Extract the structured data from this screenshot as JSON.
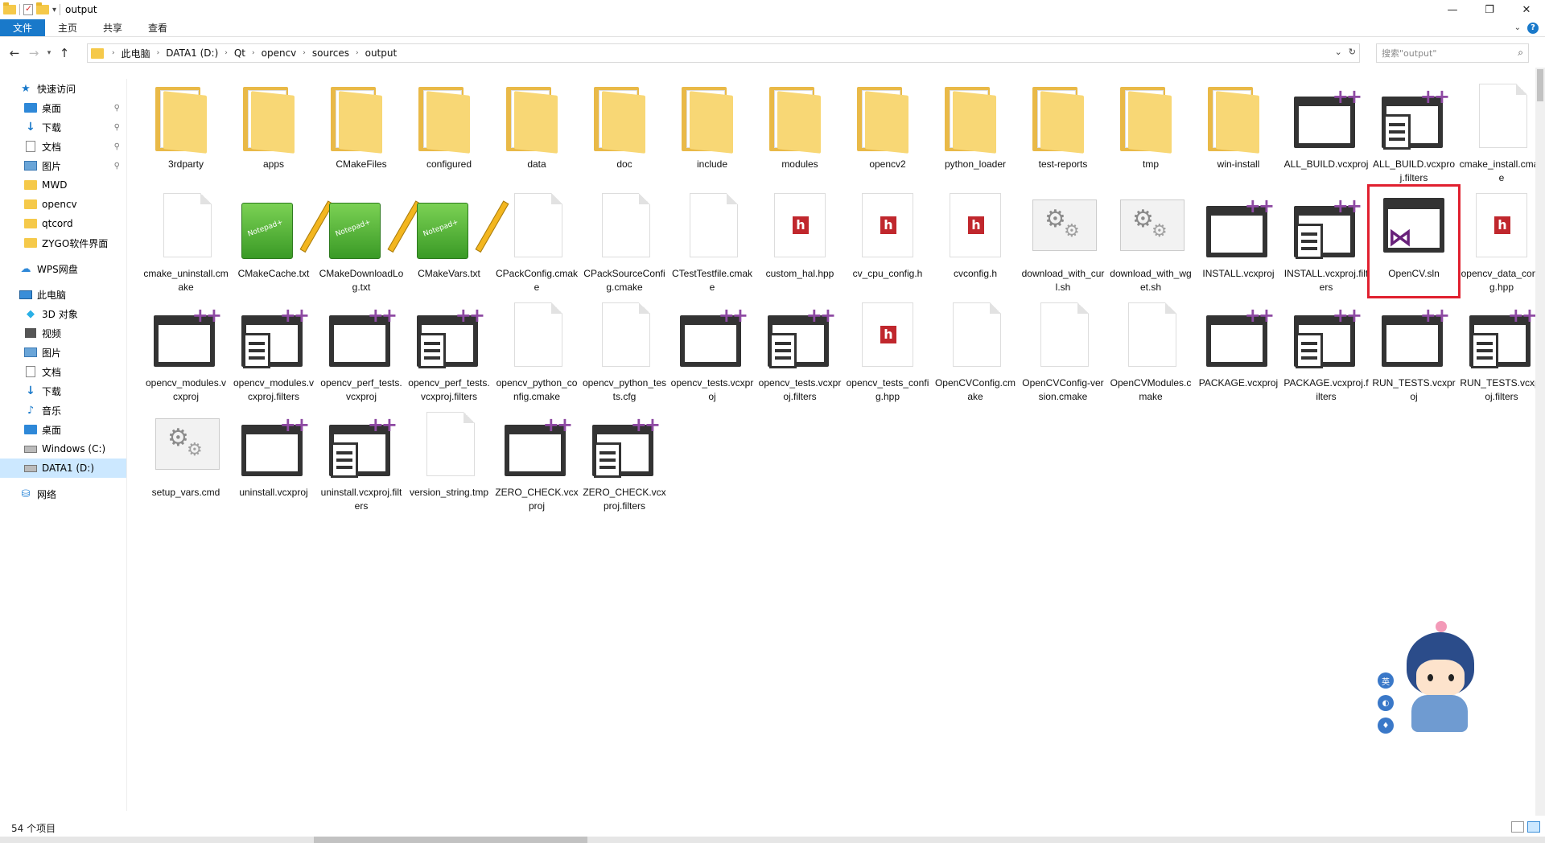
{
  "window": {
    "title": "output",
    "minimize": "—",
    "maximize": "❐",
    "close": "✕"
  },
  "ribbon": {
    "tabs": [
      "文件",
      "主页",
      "共享",
      "查看"
    ]
  },
  "address": {
    "crumbs": [
      "此电脑",
      "DATA1 (D:)",
      "Qt",
      "opencv",
      "sources",
      "output"
    ]
  },
  "search": {
    "placeholder": "搜索\"output\""
  },
  "sidebar": {
    "items": [
      {
        "label": "快速访问",
        "icon": "star-icon",
        "indent": 0,
        "pinned": false
      },
      {
        "label": "桌面",
        "icon": "desktop-icon",
        "indent": 1,
        "pinned": true
      },
      {
        "label": "下载",
        "icon": "download-icon",
        "indent": 1,
        "pinned": true
      },
      {
        "label": "文档",
        "icon": "document-icon",
        "indent": 1,
        "pinned": true
      },
      {
        "label": "图片",
        "icon": "pictures-icon",
        "indent": 1,
        "pinned": true
      },
      {
        "label": "MWD",
        "icon": "folder-icon",
        "indent": 1,
        "pinned": false
      },
      {
        "label": "opencv",
        "icon": "folder-icon",
        "indent": 1,
        "pinned": false
      },
      {
        "label": "qtcord",
        "icon": "folder-icon",
        "indent": 1,
        "pinned": false
      },
      {
        "label": "ZYGO软件界面",
        "icon": "folder-icon",
        "indent": 1,
        "pinned": false
      },
      {
        "label": "WPS网盘",
        "icon": "cloud-icon",
        "indent": 0,
        "pinned": false
      },
      {
        "label": "此电脑",
        "icon": "computer-icon",
        "indent": 0,
        "pinned": false
      },
      {
        "label": "3D 对象",
        "icon": "3d-objects-icon",
        "indent": 1,
        "pinned": false
      },
      {
        "label": "视频",
        "icon": "video-icon",
        "indent": 1,
        "pinned": false
      },
      {
        "label": "图片",
        "icon": "pictures-icon",
        "indent": 1,
        "pinned": false
      },
      {
        "label": "文档",
        "icon": "document-icon",
        "indent": 1,
        "pinned": false
      },
      {
        "label": "下载",
        "icon": "download-icon",
        "indent": 1,
        "pinned": false
      },
      {
        "label": "音乐",
        "icon": "music-icon",
        "indent": 1,
        "pinned": false
      },
      {
        "label": "桌面",
        "icon": "desktop-icon",
        "indent": 1,
        "pinned": false
      },
      {
        "label": "Windows (C:)",
        "icon": "drive-icon",
        "indent": 1,
        "pinned": false
      },
      {
        "label": "DATA1 (D:)",
        "icon": "drive-icon",
        "indent": 1,
        "pinned": false,
        "selected": true
      },
      {
        "label": "网络",
        "icon": "network-icon",
        "indent": 0,
        "pinned": false
      }
    ]
  },
  "files": [
    {
      "name": "3rdparty",
      "type": "folder"
    },
    {
      "name": "apps",
      "type": "folder"
    },
    {
      "name": "CMakeFiles",
      "type": "folder"
    },
    {
      "name": "configured",
      "type": "folder"
    },
    {
      "name": "data",
      "type": "folder"
    },
    {
      "name": "doc",
      "type": "folder"
    },
    {
      "name": "include",
      "type": "folder"
    },
    {
      "name": "modules",
      "type": "folder"
    },
    {
      "name": "opencv2",
      "type": "folder"
    },
    {
      "name": "python_loader",
      "type": "folder"
    },
    {
      "name": "test-reports",
      "type": "folder"
    },
    {
      "name": "tmp",
      "type": "folder"
    },
    {
      "name": "win-install",
      "type": "folder"
    },
    {
      "name": "ALL_BUILD.vcxproj",
      "type": "vcxproj"
    },
    {
      "name": "ALL_BUILD.vcxproj.filters",
      "type": "filters"
    },
    {
      "name": "cmake_install.cmake",
      "type": "blank"
    },
    {
      "name": "cmake_uninstall.cmake",
      "type": "blank"
    },
    {
      "name": "CMakeCache.txt",
      "type": "notepad"
    },
    {
      "name": "CMakeDownloadLog.txt",
      "type": "notepad"
    },
    {
      "name": "CMakeVars.txt",
      "type": "notepad"
    },
    {
      "name": "CPackConfig.cmake",
      "type": "blank"
    },
    {
      "name": "CPackSourceConfig.cmake",
      "type": "blank"
    },
    {
      "name": "CTestTestfile.cmake",
      "type": "blank"
    },
    {
      "name": "custom_hal.hpp",
      "type": "header"
    },
    {
      "name": "cv_cpu_config.h",
      "type": "header"
    },
    {
      "name": "cvconfig.h",
      "type": "header"
    },
    {
      "name": "download_with_curl.sh",
      "type": "gear"
    },
    {
      "name": "download_with_wget.sh",
      "type": "gear"
    },
    {
      "name": "INSTALL.vcxproj",
      "type": "vcxproj"
    },
    {
      "name": "INSTALL.vcxproj.filters",
      "type": "filters"
    },
    {
      "name": "OpenCV.sln",
      "type": "sln",
      "highlighted": true
    },
    {
      "name": "opencv_data_config.hpp",
      "type": "header"
    },
    {
      "name": "opencv_modules.vcxproj",
      "type": "vcxproj"
    },
    {
      "name": "opencv_modules.vcxproj.filters",
      "type": "filters"
    },
    {
      "name": "opencv_perf_tests.vcxproj",
      "type": "vcxproj"
    },
    {
      "name": "opencv_perf_tests.vcxproj.filters",
      "type": "filters"
    },
    {
      "name": "opencv_python_config.cmake",
      "type": "blank"
    },
    {
      "name": "opencv_python_tests.cfg",
      "type": "blank"
    },
    {
      "name": "opencv_tests.vcxproj",
      "type": "vcxproj"
    },
    {
      "name": "opencv_tests.vcxproj.filters",
      "type": "filters"
    },
    {
      "name": "opencv_tests_config.hpp",
      "type": "header"
    },
    {
      "name": "OpenCVConfig.cmake",
      "type": "blank"
    },
    {
      "name": "OpenCVConfig-version.cmake",
      "type": "blank"
    },
    {
      "name": "OpenCVModules.cmake",
      "type": "blank"
    },
    {
      "name": "PACKAGE.vcxproj",
      "type": "vcxproj"
    },
    {
      "name": "PACKAGE.vcxproj.filters",
      "type": "filters"
    },
    {
      "name": "RUN_TESTS.vcxproj",
      "type": "vcxproj"
    },
    {
      "name": "RUN_TESTS.vcxproj.filters",
      "type": "filters"
    },
    {
      "name": "setup_vars.cmd",
      "type": "gear"
    },
    {
      "name": "uninstall.vcxproj",
      "type": "vcxproj"
    },
    {
      "name": "uninstall.vcxproj.filters",
      "type": "filters"
    },
    {
      "name": "version_string.tmp",
      "type": "blank"
    },
    {
      "name": "ZERO_CHECK.vcxproj",
      "type": "vcxproj"
    },
    {
      "name": "ZERO_CHECK.vcxproj.filters",
      "type": "filters"
    }
  ],
  "status": {
    "count": "54 个项目"
  },
  "colors": {
    "accent": "#1979ca",
    "highlight": "#e0202f",
    "folder": "#f8d775",
    "vs_purple": "#68217a"
  }
}
